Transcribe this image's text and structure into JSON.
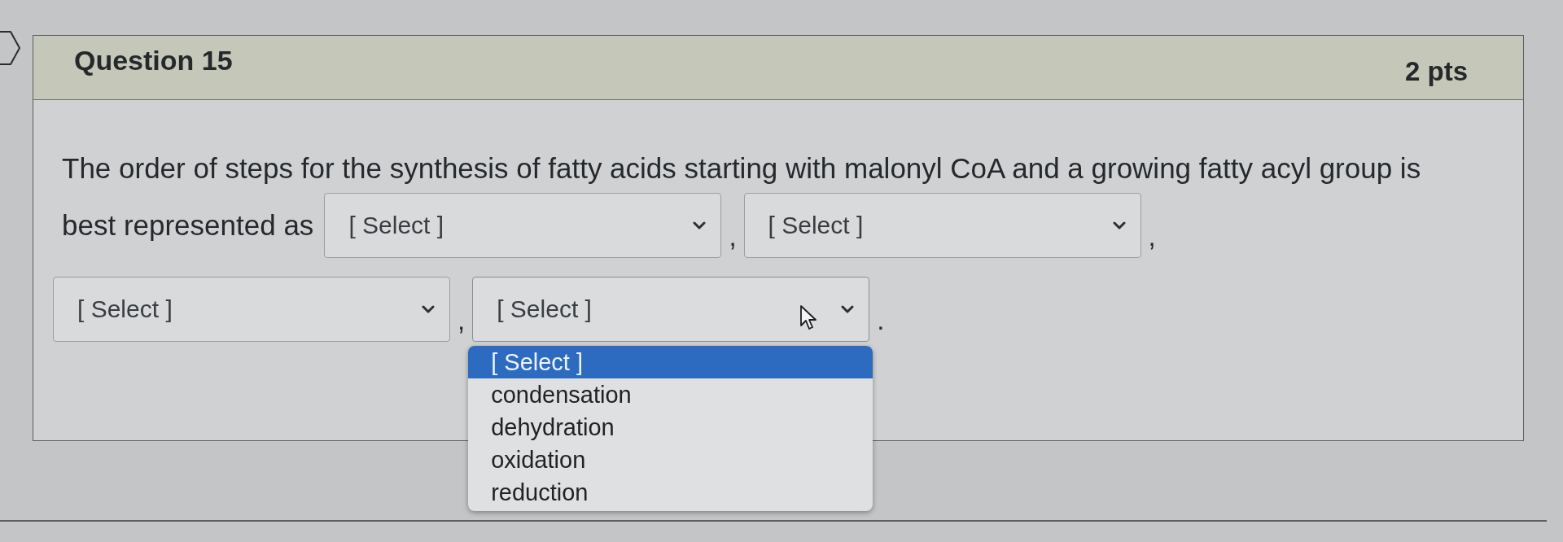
{
  "question": {
    "title": "Question 15",
    "points": "2 pts"
  },
  "prompt_lines": [
    [
      {
        "kind": "text",
        "text": "The order of steps for the synthesis of fatty acids starting with malonyl CoA and a growing fatty acyl group is"
      }
    ],
    [
      {
        "kind": "text",
        "text": "best represented as"
      },
      {
        "kind": "select",
        "value": "[ Select ]",
        "expanded": false
      },
      {
        "kind": "punctuation",
        "text": ","
      },
      {
        "kind": "select",
        "value": "[ Select ]",
        "expanded": false
      },
      {
        "kind": "punctuation",
        "text": ","
      }
    ],
    [
      {
        "kind": "select",
        "value": "[ Select ]",
        "expanded": false
      },
      {
        "kind": "punctuation",
        "text": ","
      },
      {
        "kind": "select",
        "value": "[ Select ]",
        "expanded": true,
        "options": [
          {
            "label": "[ Select ]",
            "selected": true
          },
          {
            "label": "condensation",
            "selected": false
          },
          {
            "label": "dehydration",
            "selected": false
          },
          {
            "label": "oxidation",
            "selected": false
          },
          {
            "label": "reduction",
            "selected": false
          }
        ]
      },
      {
        "kind": "punctuation",
        "text": "."
      }
    ]
  ]
}
